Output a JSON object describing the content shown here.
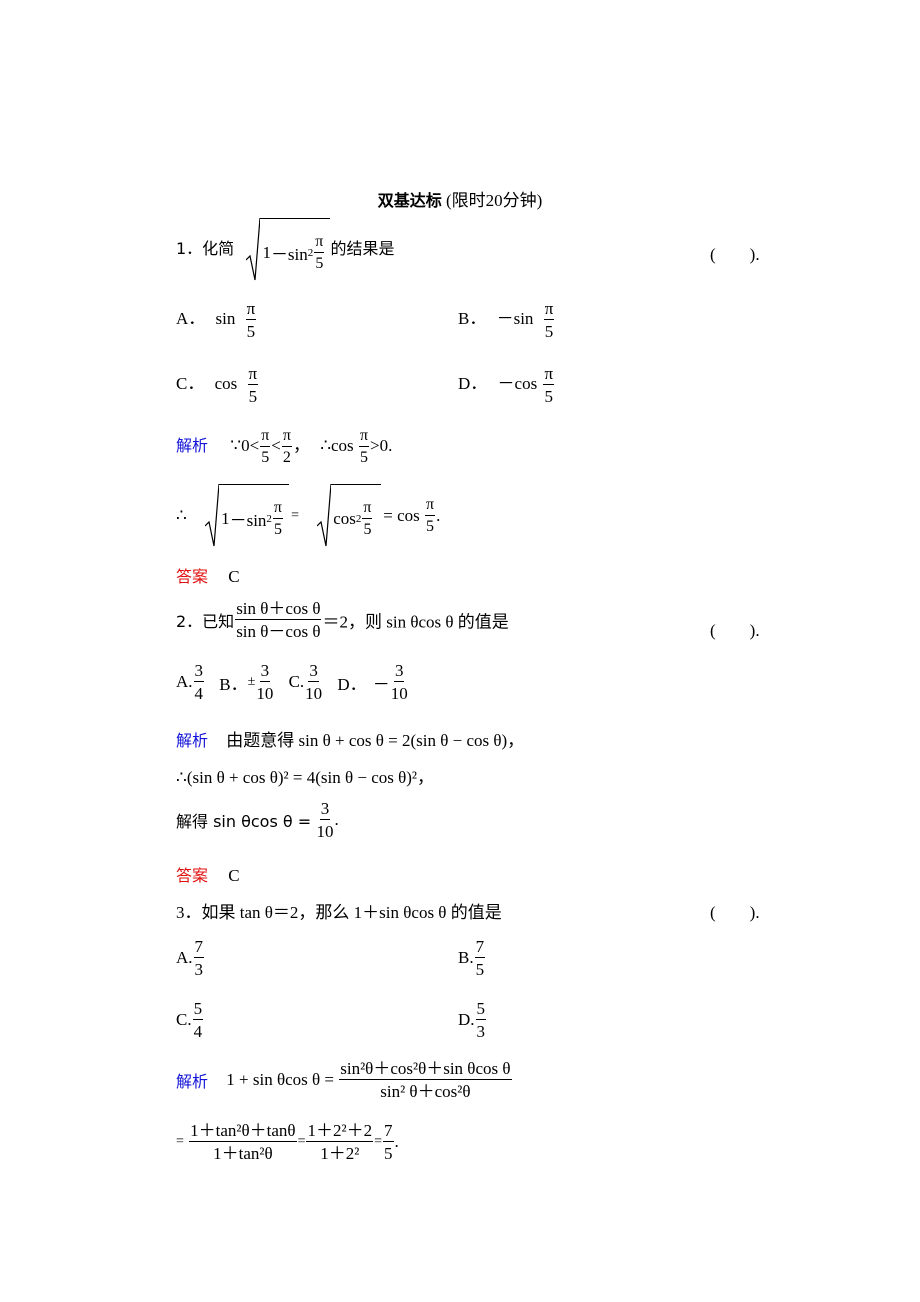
{
  "title": {
    "bold": "双基达标",
    "normal": " (限时20分钟)"
  },
  "labels": {
    "analysis": "解析",
    "answer": "答案",
    "paren": "(　　).",
    "therefore": "∴",
    "because": "∵"
  },
  "q1": {
    "number": "1．化简",
    "expr_one": "1",
    "expr_minus": "－sin",
    "sup2": "2",
    "pi": "π",
    "five": "5",
    "suffix": "的结果是",
    "options": [
      {
        "letter": "A．",
        "prefix": "sin",
        "num": "π",
        "den": "5"
      },
      {
        "letter": "B．",
        "prefix": "－sin",
        "num": "π",
        "den": "5"
      },
      {
        "letter": "C．",
        "prefix": "cos",
        "num": "π",
        "den": "5"
      },
      {
        "letter": "D．",
        "prefix": "－cos",
        "num": "π",
        "den": "5"
      }
    ],
    "analysis_line1": {
      "a": "0<",
      "b": "<",
      "c": "，",
      "d": "cos",
      "e": ">0.",
      "two": "2"
    },
    "analysis_line2": {
      "eq": "=",
      "cos2": "cos",
      "eq2": "= cos",
      "end": "."
    },
    "answer": "C"
  },
  "q2": {
    "number": "2．已知",
    "frac_num": "sin θ＋cos θ",
    "frac_den": "sin θ－cos θ",
    "suffix": "＝2，则 sin θcos θ 的值是",
    "options": [
      {
        "letter": "A.",
        "sign": "",
        "num": "3",
        "den": "4"
      },
      {
        "letter": "B．",
        "sign": "±",
        "num": "3",
        "den": "10"
      },
      {
        "letter": "C.",
        "sign": "",
        "num": "3",
        "den": "10"
      },
      {
        "letter": "D．",
        "sign": "－",
        "num": "3",
        "den": "10"
      }
    ],
    "analysis_line1": "由题意得 sin θ + cos θ = 2(sin θ − cos θ)，",
    "analysis_line2": "(sin θ + cos θ)² = 4(sin θ − cos θ)²，",
    "analysis_line3_prefix": "解得 sin θcos θ =",
    "analysis_line3_num": "3",
    "analysis_line3_den": "10",
    "analysis_line3_end": ".",
    "answer": "C"
  },
  "q3": {
    "stem": "3．如果 tan θ＝2，那么 1＋sin θcos θ 的值是",
    "options": [
      {
        "letter": "A.",
        "num": "7",
        "den": "3"
      },
      {
        "letter": "B.",
        "num": "7",
        "den": "5"
      },
      {
        "letter": "C.",
        "num": "5",
        "den": "4"
      },
      {
        "letter": "D.",
        "num": "5",
        "den": "3"
      }
    ],
    "analysis_lhs": "1 + sin θcos θ =",
    "frac1_num": "sin²θ＋cos²θ＋sin θcos θ",
    "frac1_den": "sin² θ＋cos²θ",
    "eq": "=",
    "frac2_num": "1＋tan²θ＋tanθ",
    "frac2_den": "1＋tan²θ",
    "frac3_num": "1＋2²＋2",
    "frac3_den": "1＋2²",
    "frac4_num": "7",
    "frac4_den": "5",
    "end": "."
  }
}
